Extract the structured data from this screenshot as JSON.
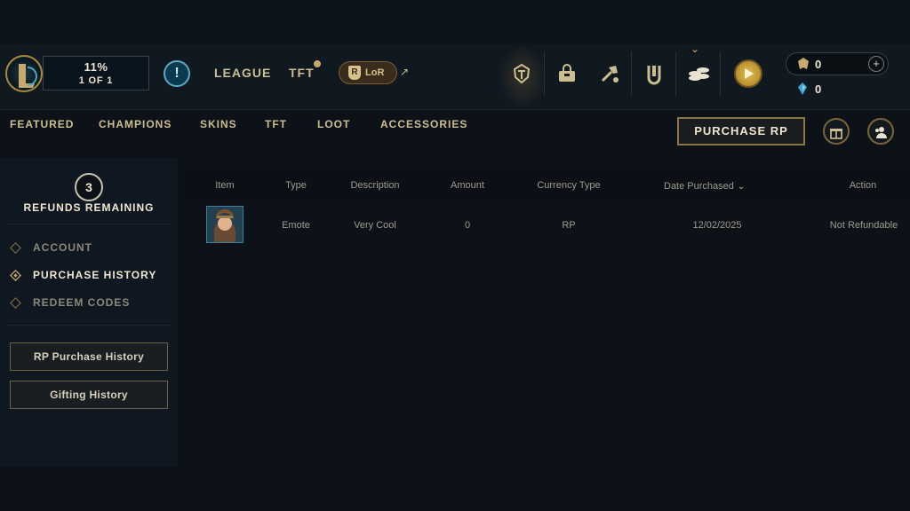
{
  "header": {
    "progress": {
      "percent": "11%",
      "level": "1 OF 1"
    },
    "alert_icon": "exclamation-icon",
    "games": {
      "league": "LEAGUE",
      "tft": "TFT",
      "lor": "LoR"
    },
    "icons": [
      "champion-helm-icon",
      "store-bag-icon",
      "loot-hammer-icon",
      "collection-icon",
      "currency-coins-icon"
    ],
    "currency": {
      "rp": "0",
      "be": "0"
    },
    "accent": "#c8aa6e"
  },
  "store_nav": {
    "tabs": [
      "FEATURED",
      "CHAMPIONS",
      "SKINS",
      "TFT",
      "LOOT",
      "ACCESSORIES"
    ],
    "purchase_rp": "PURCHASE RP"
  },
  "sidebar": {
    "refunds_count": "3",
    "refunds_label": "REFUNDS REMAINING",
    "items": [
      {
        "label": "ACCOUNT",
        "active": false
      },
      {
        "label": "PURCHASE HISTORY",
        "active": true
      },
      {
        "label": "REDEEM CODES",
        "active": false
      }
    ],
    "buttons": {
      "rp_history": "RP Purchase History",
      "gifting_history": "Gifting History"
    }
  },
  "table": {
    "headers": [
      "Item",
      "Type",
      "Description",
      "Amount",
      "Currency Type",
      "Date Purchased",
      "Action"
    ],
    "rows": [
      {
        "type": "Emote",
        "description": "Very Cool",
        "amount": "0",
        "currency": "RP",
        "date": "12/02/2025",
        "action": "Not Refundable"
      }
    ]
  }
}
